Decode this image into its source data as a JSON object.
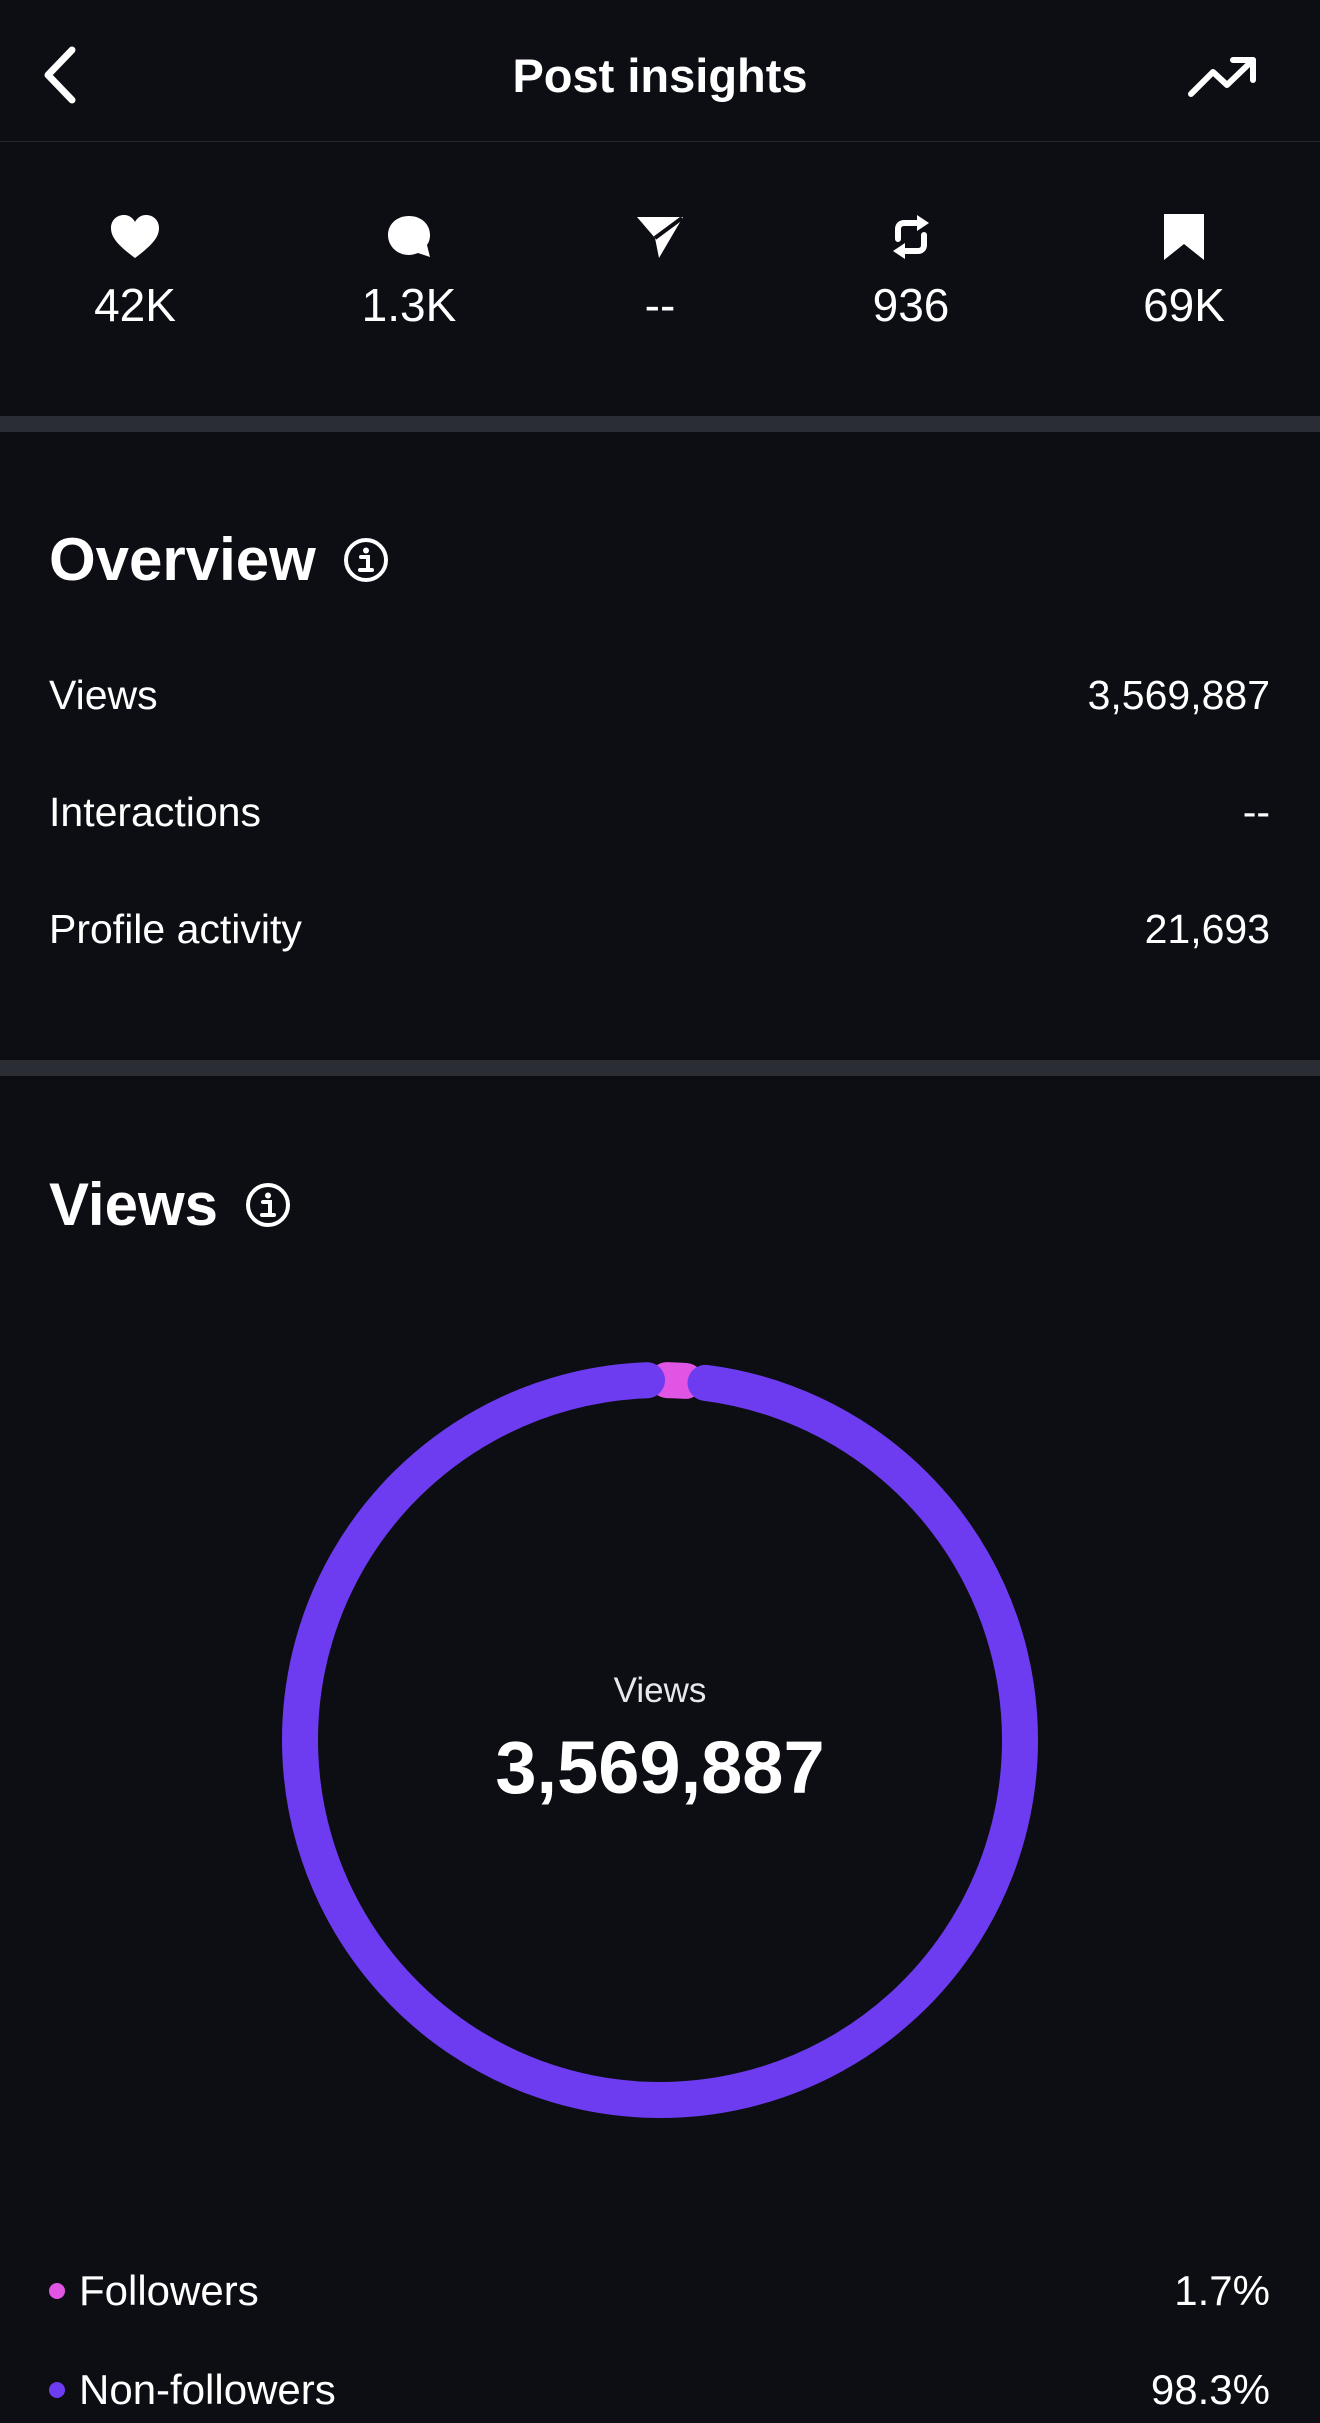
{
  "header": {
    "title": "Post insights"
  },
  "stats": [
    {
      "icon": "heart-icon",
      "value": "42K"
    },
    {
      "icon": "comment-icon",
      "value": "1.3K"
    },
    {
      "icon": "send-icon",
      "value": "--"
    },
    {
      "icon": "repost-icon",
      "value": "936"
    },
    {
      "icon": "bookmark-icon",
      "value": "69K"
    }
  ],
  "overview": {
    "title": "Overview",
    "rows": [
      {
        "label": "Views",
        "value": "3,569,887"
      },
      {
        "label": "Interactions",
        "value": "--"
      },
      {
        "label": "Profile activity",
        "value": "21,693"
      }
    ]
  },
  "views": {
    "title": "Views",
    "center_label": "Views",
    "center_value": "3,569,887",
    "legend": [
      {
        "label": "Followers",
        "value": "1.7%",
        "color": "#e055e3"
      },
      {
        "label": "Non-followers",
        "value": "98.3%",
        "color": "#6e3cf0"
      }
    ]
  },
  "chart_data": {
    "type": "pie",
    "categories": [
      "Followers",
      "Non-followers"
    ],
    "values": [
      1.7,
      98.3
    ],
    "colors": [
      "#e055e3",
      "#6e3cf0"
    ]
  }
}
